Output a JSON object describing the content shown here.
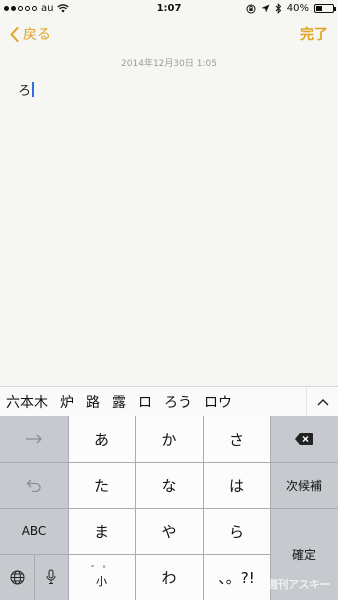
{
  "status_bar": {
    "carrier": "au",
    "time": "1:07",
    "battery": "40%",
    "signal_bars_filled": 2,
    "signal_bars_total": 5,
    "battery_level": 0.4
  },
  "nav": {
    "back_label": "戻る",
    "done_label": "完了",
    "accent_color": "#e1a320"
  },
  "note": {
    "date": "2014年12月30日 1:05",
    "text": "ろ"
  },
  "candidates": [
    "六本木",
    "炉",
    "路",
    "露",
    "ロ",
    "ろう",
    "ロウ"
  ],
  "keyboard": {
    "row1": [
      "あ",
      "か",
      "さ"
    ],
    "row2": [
      "た",
      "な",
      "は"
    ],
    "row3": [
      "ま",
      "や",
      "ら"
    ],
    "row4_left": "小",
    "row4_left_top": "゛ ゜",
    "row4_mid": "わ",
    "row4_right": "、。?!",
    "next_candidate": "次候補",
    "abc": "ABC",
    "confirm": "確定"
  },
  "watermark": "週刊アスキー"
}
